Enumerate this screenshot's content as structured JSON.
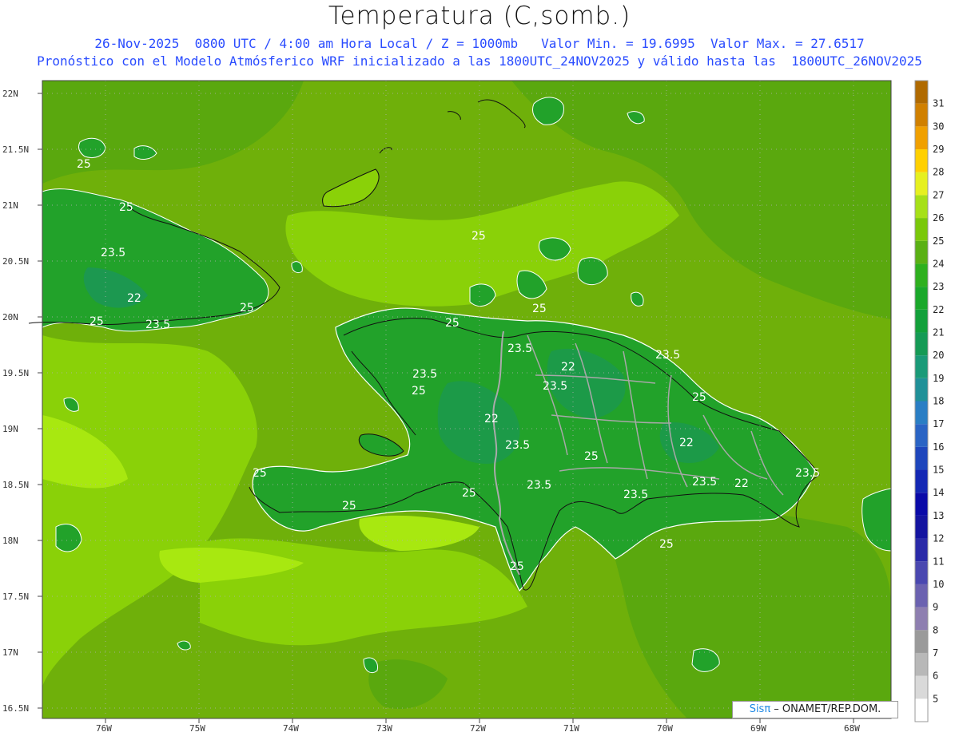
{
  "title": "Temperatura (C,somb.)",
  "subtitle_line1": "26-Nov-2025  0800 UTC / 4:00 am Hora Local / Z = 1000mb   Valor Min. = 19.6995  Valor Max. = 27.6517",
  "subtitle_line2": "Pronóstico con el Modelo Atmósferico WRF inicializado a las 1800UTC_24NOV2025 y válido hasta las  1800UTC_26NOV2025",
  "credit": {
    "brand": "Sisπ",
    "text": " – ONAMET/REP.DOM."
  },
  "lat_labels": [
    "22N",
    "21.5N",
    "21N",
    "20.5N",
    "20N",
    "19.5N",
    "19N",
    "18.5N",
    "18N",
    "17.5N",
    "17N",
    "16.5N"
  ],
  "lon_labels": [
    "76W",
    "75W",
    "74W",
    "73W",
    "72W",
    "71W",
    "70W",
    "69W",
    "68W"
  ],
  "contour_labels": [
    "25",
    "25",
    "23.5",
    "22",
    "25",
    "23.5",
    "25",
    "25",
    "25",
    "23.5",
    "22",
    "23.5",
    "23.5",
    "25",
    "22",
    "23.5",
    "22",
    "23.5",
    "25",
    "25",
    "23.5",
    "23.5",
    "25",
    "25",
    "25",
    "25",
    "23.5",
    "22",
    "23.5",
    "25",
    "25"
  ],
  "colorbar": {
    "ticks": [
      "5",
      "6",
      "7",
      "8",
      "9",
      "10",
      "11",
      "12",
      "13",
      "14",
      "15",
      "16",
      "17",
      "18",
      "19",
      "20",
      "21",
      "22",
      "23",
      "24",
      "25",
      "26",
      "27",
      "28",
      "29",
      "30",
      "31"
    ],
    "colors": [
      "#ffffff",
      "#d9d9d9",
      "#b8b8b8",
      "#9a9a9a",
      "#8e7fb0",
      "#6b62b0",
      "#4a48b0",
      "#2a2aa8",
      "#1414a0",
      "#0a0aa8",
      "#1428b4",
      "#1e46bc",
      "#2a64c4",
      "#2a7ec4",
      "#209098",
      "#1a9a78",
      "#159a55",
      "#12a03a",
      "#1aa82a",
      "#2eb01e",
      "#5ab014",
      "#7ac80a",
      "#a6e018",
      "#e6f020",
      "#ffd000",
      "#f0a000",
      "#d08000",
      "#b06a00"
    ]
  }
}
